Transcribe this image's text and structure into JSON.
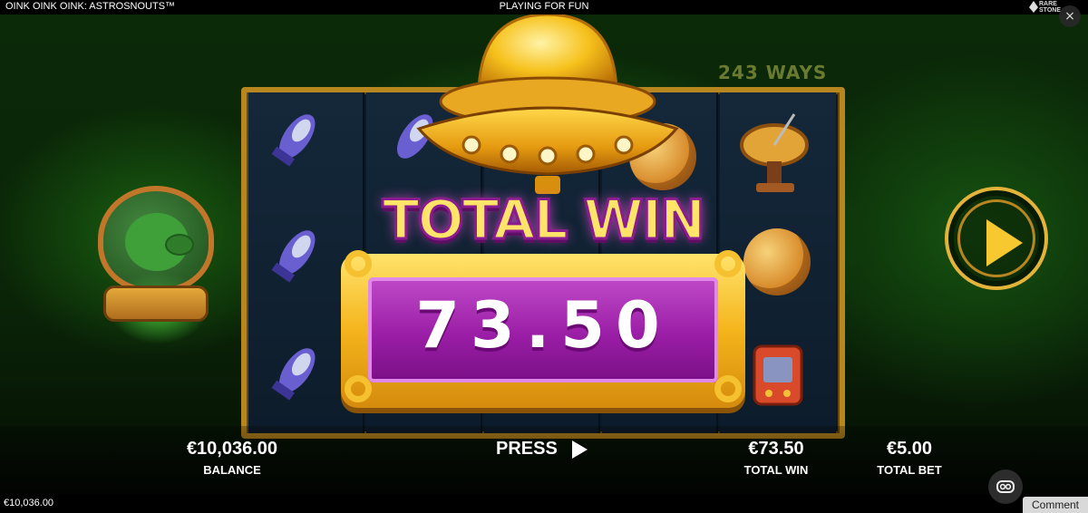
{
  "top_bar": {
    "game_title": "OINK OINK OINK: ASTROSNOUTS™",
    "mode": "PLAYING FOR FUN",
    "brand": [
      "RARE",
      "STONE"
    ],
    "close_icon": "×"
  },
  "game": {
    "ways_label": "243 WAYS",
    "total_win_label": "TOTAL WIN",
    "total_win_value": "73.50",
    "press_label": "PRESS"
  },
  "stats": {
    "balance_value": "€10,036.00",
    "balance_label": "BALANCE",
    "total_win_value": "€73.50",
    "total_win_label": "TOTAL WIN",
    "total_bet_value": "€5.00",
    "total_bet_label": "TOTAL BET"
  },
  "footer": {
    "balance": "€10,036.00",
    "comment_label": "Comment"
  },
  "colors": {
    "gold": "#f4b41c",
    "magenta": "#9a1ea6",
    "background": "#0b2a08"
  },
  "icons": [
    "close-icon",
    "play-icon",
    "press-arrow-icon",
    "captions-icon",
    "rocket-icon",
    "planet-icon",
    "satellite-dish-icon",
    "ufo-icon",
    "pig-astronaut-icon",
    "radio-icon"
  ]
}
